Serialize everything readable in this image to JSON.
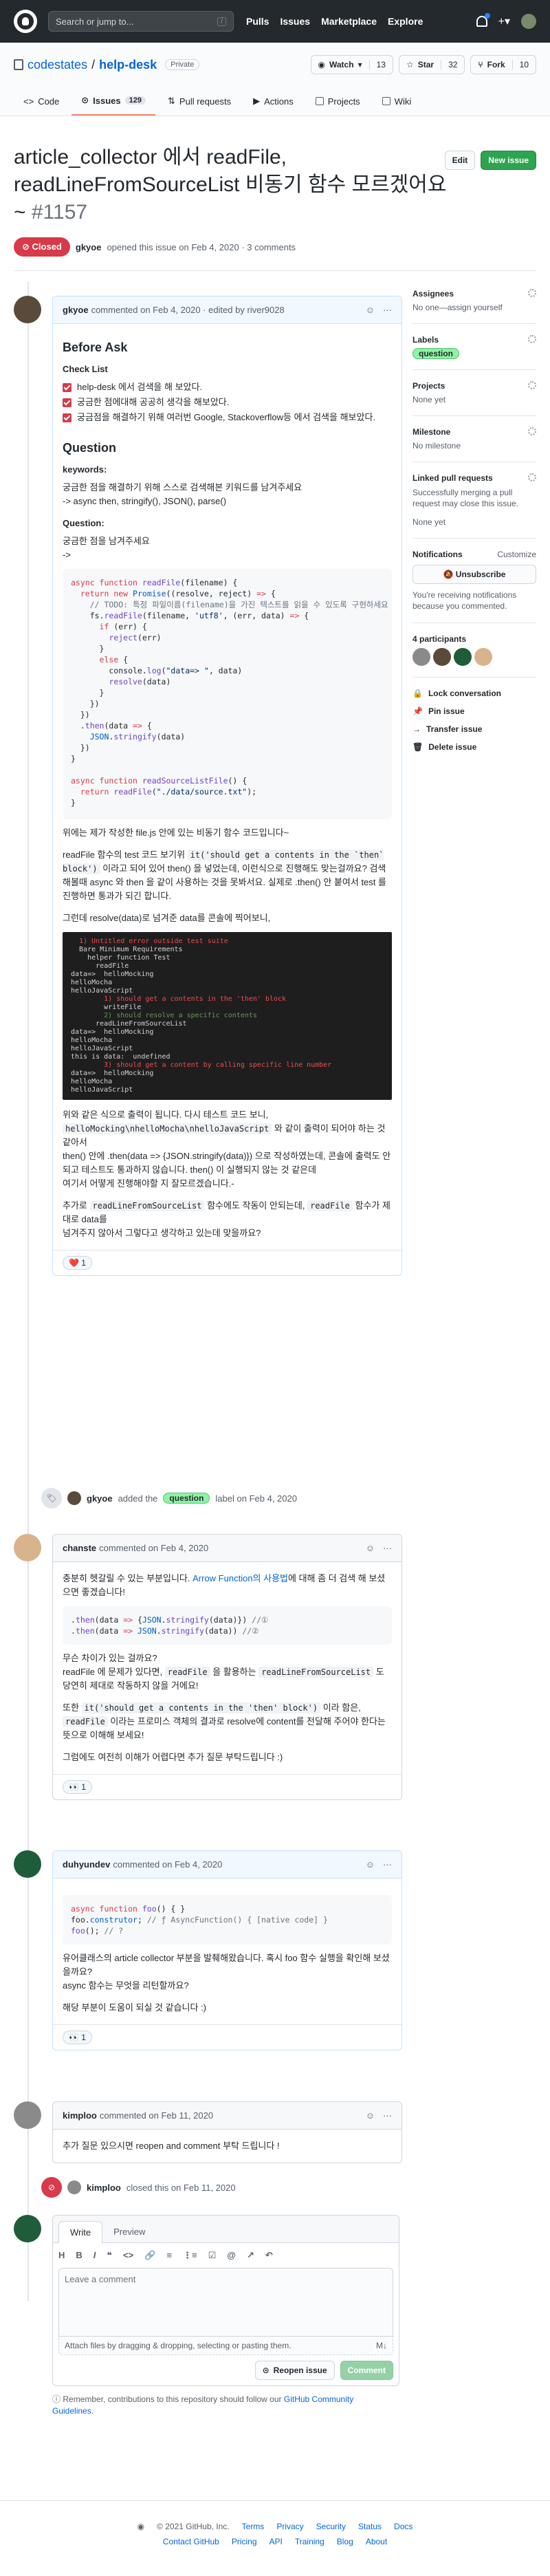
{
  "header": {
    "search_placeholder": "Search or jump to...",
    "slash": "/",
    "nav": [
      "Pulls",
      "Issues",
      "Marketplace",
      "Explore"
    ]
  },
  "repo": {
    "owner": "codestates",
    "sep": "/",
    "name": "help-desk",
    "visibility": "Private",
    "watch": {
      "label": "Watch",
      "count": "13"
    },
    "star": {
      "label": "Star",
      "count": "32"
    },
    "fork": {
      "label": "Fork",
      "count": "10"
    },
    "tabs": [
      {
        "label": "Code"
      },
      {
        "label": "Issues",
        "count": "129"
      },
      {
        "label": "Pull requests"
      },
      {
        "label": "Actions"
      },
      {
        "label": "Projects"
      },
      {
        "label": "Wiki"
      }
    ]
  },
  "issue": {
    "title": "article_collector 에서 readFile, readLineFromSourceList 비동기 함수 모르겠어요~",
    "number": "#1157",
    "edit": "Edit",
    "new_issue": "New issue",
    "state": "Closed",
    "author": "gkyoe",
    "opened": "opened this issue on Feb 4, 2020 · 3 comments"
  },
  "c1": {
    "author": "gkyoe",
    "meta": "commented on Feb 4, 2020 · edited by river9028",
    "h_before": "Before Ask",
    "h_check": "Check List",
    "checks": [
      "help-desk 에서 검색을 해 보았다.",
      "궁금한 점에대해 공공히 생각을 해보았다.",
      "궁금점을 해결하기 위해 여러번 Google, Stackoverflow등 에서 검색을 해보았다."
    ],
    "h_question": "Question",
    "h_keywords": "keywords:",
    "kw1": "궁금한 점을 해결하기 위해 스스로 검색해본 키워드를 남겨주세요",
    "kw2": "-> async then, stringify(), JSON(), parse()",
    "h_q": "Question:",
    "q1": "궁금한 점을 남겨주세요",
    "q2": "->",
    "p1": "위에는 제가 작성한 file.js 안에 있는 비동기 함수 코드입니다~",
    "p2a": "readFile 함수의 test 코드 보기위 ",
    "p2code": "it('should get a contents in the `then` block')",
    "p2b": " 이라고 되어 있어 then() 을 넣었는데, 이런식으로 진행해도 맞는걸까요? 검색해볼때 async 와 then 을 같이 사용하는 것을 못봐서요. 실제로 .then() 안 붙여서 test 를 진행하면 통과가 되긴 합니다.",
    "p3": "그런데 resolve(data)로 넘겨준 data를 콘솔에 찍어보니,",
    "p4a": "위와 같은 식으로 출력이 됩니다. 다시 테스트 코드 보니,",
    "p4code": "helloMocking\\nhelloMocha\\nhelloJavaScript",
    "p4b": " 와 같이 출력이 되어야 하는 것 같아서",
    "p4c": "then() 안에 .then(data => {JSON.stringify(data)}) 으로 작성하였는데, 콘솔에 출력도 안되고 테스트도 통과하지 않습니다. then() 이 실행되지 않는 것 같은데",
    "p4d": "여기서 어떻게 진행해야할 지 잘모르겠습니다.-",
    "p5a": "추가로 ",
    "p5code1": "readLineFromSourceList",
    "p5b": " 함수에도 작동이 안되는데, ",
    "p5code2": "readFile",
    "p5c": " 함수가 제대로 data를",
    "p5d": "넘겨주지 않아서 그렇다고 생각하고 있는데 맞을까요?",
    "reaction": "❤️ 1"
  },
  "event1": {
    "actor": "gkyoe",
    "text": "added the",
    "label": "question",
    "suffix": "label on Feb 4, 2020"
  },
  "c2": {
    "author": "chanste",
    "meta": "commented on Feb 4, 2020",
    "p1a": "충분히 헷갈릴 수 있는 부분입니다. ",
    "p1link": "Arrow Function의 사용법",
    "p1b": "에 대해 좀 더 검색 해 보셨으면 좋겠습니다!",
    "p2": "무슨 차이가 있는 걸까요?",
    "p3a": "readFile 에 문제가 있다면, ",
    "p3code1": "readFile",
    "p3b": " 을 활용하는 ",
    "p3code2": "readLineFromSourceList",
    "p3c": " 도 당연히 제대로 작동하지 않을 거에요!",
    "p4a": "또한 ",
    "p4code": "it('should get a contents in the 'then' block')",
    "p4b": " 이라 함은, ",
    "p4code2": "readFile",
    "p4c": " 이라는 프로미스 객체의 결과로 resolve에 content를 전달해 주어야 한다는 뜻으로 이해해 보세요!",
    "p5": "그럼에도 여전히 이해가 어렵다면 추가 질문 부탁드립니다 :)",
    "reaction": "👀 1"
  },
  "c3": {
    "author": "duhyundev",
    "meta": "commented on Feb 4, 2020",
    "p1": "유어클래스의 article collector 부분을 발췌해왔습니다. 혹시 foo 함수 실행을 확인해 보셨을까요?",
    "p2": "async 함수는 무엇을 리턴할까요?",
    "p3": "해당 부분이 도움이 되실 것 같습니다 :)",
    "reaction": "👀 1"
  },
  "c4": {
    "author": "kimploo",
    "meta": "commented on Feb 11, 2020",
    "p1": "추가 질문 있으시면 reopen and comment 부탁 드립니다 !"
  },
  "event2": {
    "actor": "kimploo",
    "text": "closed this on Feb 11, 2020"
  },
  "sidebar": {
    "assignees": "Assignees",
    "assignees_val": "No one—assign yourself",
    "labels": "Labels",
    "label_val": "question",
    "projects": "Projects",
    "projects_val": "None yet",
    "milestone": "Milestone",
    "milestone_val": "No milestone",
    "linked": "Linked pull requests",
    "linked_desc": "Successfully merging a pull request may close this issue.",
    "linked_val": "None yet",
    "notifications": "Notifications",
    "customize": "Customize",
    "unsubscribe": "Unsubscribe",
    "notif_desc": "You're receiving notifications because you commented.",
    "participants": "4 participants",
    "lock": "Lock conversation",
    "pin": "Pin issue",
    "transfer": "Transfer issue",
    "delete": "Delete issue"
  },
  "newcomment": {
    "write": "Write",
    "preview": "Preview",
    "tools": [
      "H",
      "B",
      "I",
      "❝",
      "<>",
      "🔗",
      "≡",
      "⋮≡",
      "☑",
      "@",
      "↗",
      "↶"
    ],
    "placeholder": "Leave a comment",
    "attach": "Attach files by dragging & dropping, selecting or pasting them.",
    "md": "M↓",
    "reopen": "Reopen issue",
    "comment": "Comment",
    "remember_a": "Remember, contributions to this repository should follow our ",
    "remember_link": "GitHub Community Guidelines",
    "remember_b": "."
  },
  "footer": {
    "copy": "© 2021 GitHub, Inc.",
    "row1": [
      "Terms",
      "Privacy",
      "Security",
      "Status",
      "Docs"
    ],
    "row2": [
      "Contact GitHub",
      "Pricing",
      "API",
      "Training",
      "Blog",
      "About"
    ]
  },
  "colors": {
    "closed": "#d73a49",
    "green": "#2ea44f",
    "link": "#0366d6",
    "label_bg": "#8ef3a4"
  },
  "icons": [
    "github-logo-icon",
    "bell-icon",
    "plus-icon",
    "code-icon",
    "issue-icon",
    "pr-icon",
    "play-icon",
    "project-icon",
    "book-icon",
    "smile-icon",
    "kebab-icon",
    "tag-icon",
    "closed-icon",
    "lock-icon",
    "pin-icon",
    "arrow-icon",
    "trash-icon",
    "gear-icon",
    "info-icon"
  ]
}
